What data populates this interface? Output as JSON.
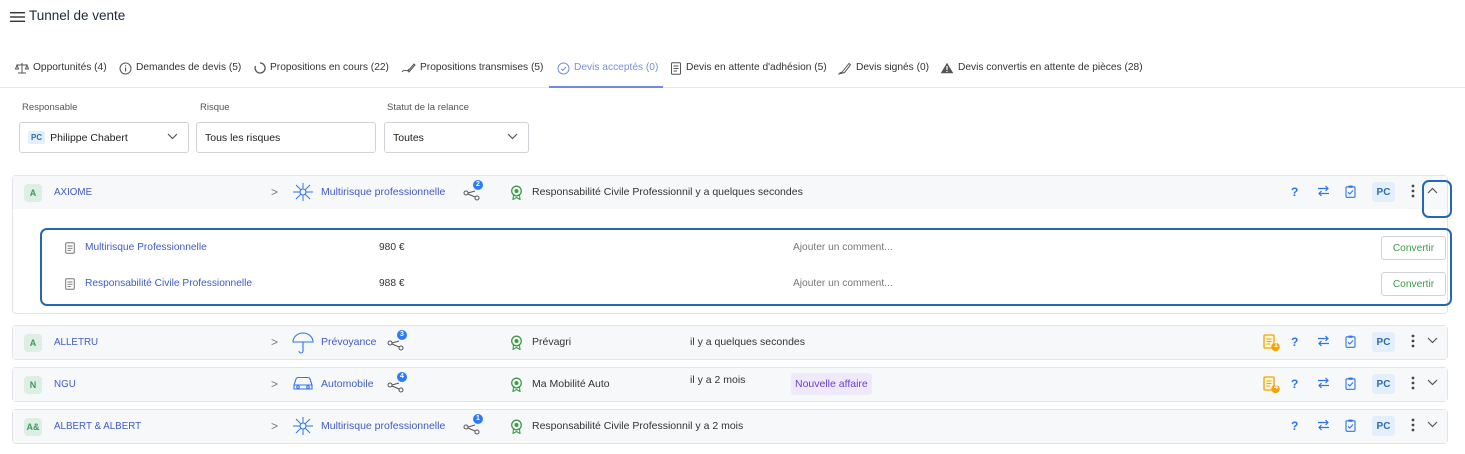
{
  "header": {
    "title": "Tunnel de vente",
    "menu_icon": "hamburger-menu-icon"
  },
  "tabs": [
    {
      "label": "Opportunités (4)",
      "icon": "balance-scale-icon",
      "active": false
    },
    {
      "label": "Demandes de devis (5)",
      "icon": "info-circle-icon",
      "active": false
    },
    {
      "label": "Propositions en cours (22)",
      "icon": "progress-circle-icon",
      "active": false
    },
    {
      "label": "Propositions transmises (5)",
      "icon": "sign-pen-icon",
      "active": false
    },
    {
      "label": "Devis acceptés (0)",
      "icon": "check-circle-icon",
      "active": true
    },
    {
      "label": "Devis en attente d'adhésion (5)",
      "icon": "document-icon",
      "active": false
    },
    {
      "label": "Devis signés (0)",
      "icon": "signature-icon",
      "active": false
    },
    {
      "label": "Devis convertis en attente de pièces (28)",
      "icon": "warning-icon",
      "active": false
    }
  ],
  "filters": {
    "responsable": {
      "label": "Responsable",
      "initials": "PC",
      "value": "Philippe Chabert"
    },
    "risque": {
      "label": "Risque",
      "value": "Tous les risques"
    },
    "statut": {
      "label": "Statut de la relance",
      "value": "Toutes"
    }
  },
  "rows": [
    {
      "initials": "A",
      "client": "AXIOME",
      "product": "Multirisque professionnelle",
      "product_icon": "network-hub-icon",
      "count": "2",
      "sub_product": "Responsabilité Civile Professionnil y a quelques secondes",
      "time": "",
      "badge": "",
      "doc_badge": "",
      "owner": "PC",
      "expanded": true,
      "items": [
        {
          "name": "Multirisque Professionnelle",
          "price": "980 €",
          "comment_placeholder": "Ajouter un comment...",
          "action": "Convertir"
        },
        {
          "name": "Responsabilité Civile Professionnelle",
          "price": "988 €",
          "comment_placeholder": "Ajouter un comment...",
          "action": "Convertir"
        }
      ]
    },
    {
      "initials": "A",
      "client": "ALLETRU",
      "product": "Prévoyance",
      "product_icon": "umbrella-icon",
      "count": "3",
      "sub_product": "Prévagri",
      "time": "il y a quelques secondes",
      "badge": "",
      "doc_badge": "1",
      "owner": "PC",
      "expanded": false
    },
    {
      "initials": "N",
      "client": "NGU",
      "product": "Automobile",
      "product_icon": "car-icon",
      "count": "4",
      "sub_product": "Ma Mobilité Auto",
      "time": "il y a 2 mois",
      "badge": "Nouvelle affaire",
      "doc_badge": "4",
      "owner": "PC",
      "expanded": false
    },
    {
      "initials": "A&",
      "client": "ALBERT & ALBERT",
      "product": "Multirisque professionnelle",
      "product_icon": "network-hub-icon",
      "count": "1",
      "sub_product": "Responsabilité Civile Professionnil y a 2 mois",
      "time": "",
      "badge": "",
      "doc_badge": "",
      "owner": "PC",
      "expanded": false
    }
  ],
  "colors": {
    "accent": "#2f74e8",
    "link": "#3f5bc9",
    "success": "#3f9a4a",
    "highlight": "#2467b3",
    "active_tab": "#7a8ee0"
  }
}
